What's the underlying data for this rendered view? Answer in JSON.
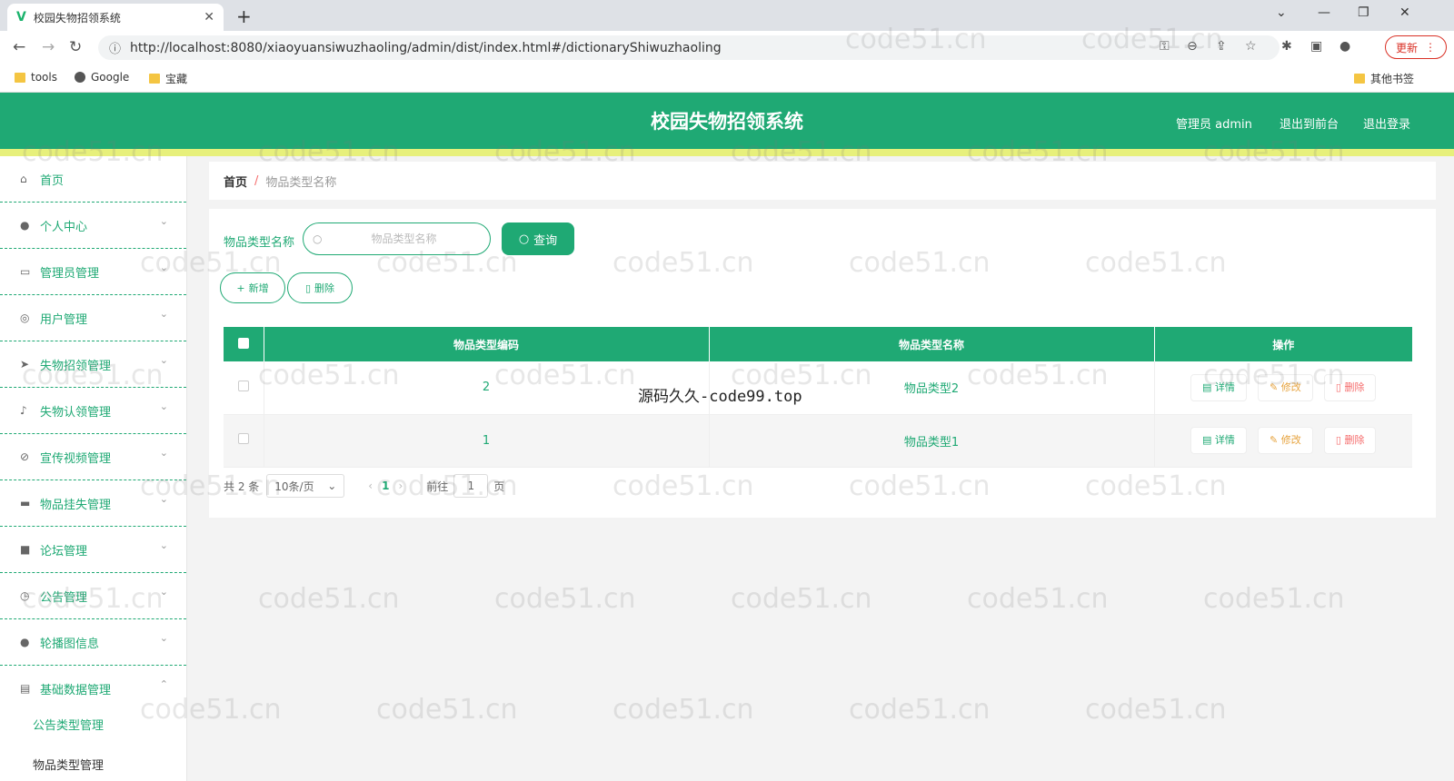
{
  "browser": {
    "tab_title": "校园失物招领系统",
    "url": "http://localhost:8080/xiaoyuansiwuzhaoling/admin/dist/index.html#/dictionaryShiwuzhaoling",
    "update_label": "更新",
    "bookmarks": [
      "tools",
      "Google",
      "宝藏"
    ],
    "other_bookmarks": "其他书签"
  },
  "header": {
    "title": "校园失物招领系统",
    "user": "管理员 admin",
    "to_front": "退出到前台",
    "logout": "退出登录"
  },
  "sidebar": {
    "items": [
      {
        "label": "首页",
        "icon": "home-icon"
      },
      {
        "label": "个人中心",
        "icon": "user-icon"
      },
      {
        "label": "管理员管理",
        "icon": "admin-icon"
      },
      {
        "label": "用户管理",
        "icon": "users-icon"
      },
      {
        "label": "失物招领管理",
        "icon": "send-icon"
      },
      {
        "label": "失物认领管理",
        "icon": "mic-icon"
      },
      {
        "label": "宣传视频管理",
        "icon": "video-icon"
      },
      {
        "label": "物品挂失管理",
        "icon": "box-icon"
      },
      {
        "label": "论坛管理",
        "icon": "forum-icon"
      },
      {
        "label": "公告管理",
        "icon": "clock-icon"
      },
      {
        "label": "轮播图信息",
        "icon": "image-icon"
      },
      {
        "label": "基础数据管理",
        "icon": "data-icon"
      }
    ],
    "subitems": [
      "公告类型管理",
      "物品类型管理"
    ]
  },
  "breadcrumb": {
    "home": "首页",
    "separator": "/",
    "current": "物品类型名称"
  },
  "search": {
    "label": "物品类型名称",
    "placeholder": "物品类型名称",
    "value": "",
    "button": "查询"
  },
  "toolbar": {
    "add": "新增",
    "delete": "删除"
  },
  "table": {
    "columns": [
      "物品类型编码",
      "物品类型名称",
      "操作"
    ],
    "rows": [
      {
        "code": "2",
        "name": "物品类型2"
      },
      {
        "code": "1",
        "name": "物品类型1"
      }
    ],
    "actions": {
      "detail": "详情",
      "edit": "修改",
      "delete": "删除"
    }
  },
  "pagination": {
    "total": "共 2 条",
    "page_size": "10条/页",
    "current_page": "1",
    "goto_label": "前往",
    "goto_value": "1",
    "page_suffix": "页"
  },
  "overlay_text": "源码久久-code99.top",
  "watermark_text": "code51.cn",
  "colors": {
    "primary": "#1fa974",
    "accent_line": "#e7f07b",
    "edit": "#e6a23c",
    "danger": "#f56c6c"
  }
}
